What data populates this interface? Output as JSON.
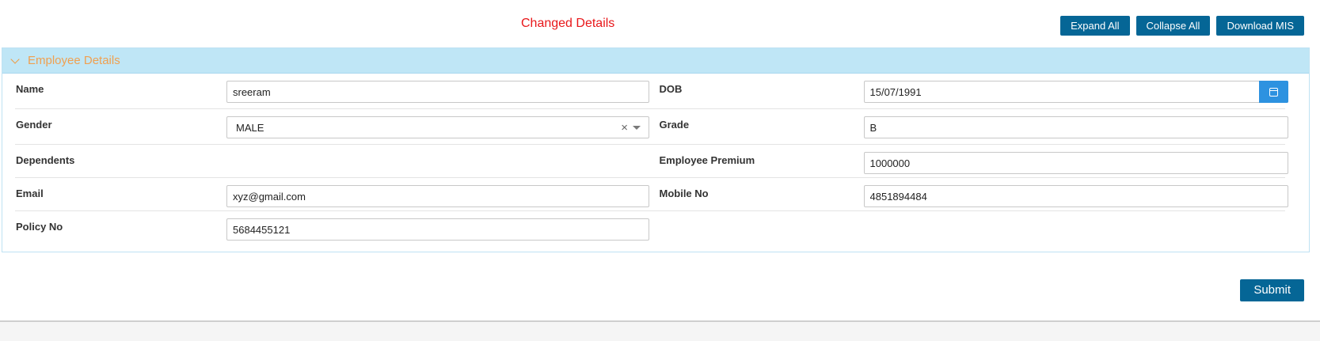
{
  "page": {
    "title": "Changed Details"
  },
  "toolbar": {
    "expand_all": "Expand All",
    "collapse_all": "Collapse All",
    "download_mis": "Download MIS"
  },
  "panel": {
    "title": "Employee Details",
    "fields": {
      "name": {
        "label": "Name",
        "value": "sreeram"
      },
      "dob": {
        "label": "DOB",
        "value": "15/07/1991"
      },
      "gender": {
        "label": "Gender",
        "value": "MALE",
        "clear": "×"
      },
      "grade": {
        "label": "Grade",
        "value": "B"
      },
      "dependents": {
        "label": "Dependents"
      },
      "employee_premium": {
        "label": "Employee Premium",
        "value": "1000000"
      },
      "email": {
        "label": "Email",
        "value": "xyz@gmail.com"
      },
      "mobile_no": {
        "label": "Mobile No",
        "value": "4851894484"
      },
      "policy_no": {
        "label": "Policy No",
        "value": "5684455121"
      }
    }
  },
  "actions": {
    "submit": "Submit"
  },
  "icons": {
    "header": "chevron-down-icon",
    "date": "calendar-icon",
    "select_clear": "clear-icon",
    "select_caret": "caret-down-icon"
  },
  "colors": {
    "primary_button": "#056696",
    "title_red": "#e8171a",
    "panel_header_bg": "#bfe6f6",
    "panel_title": "#f0a050",
    "calendar_button": "#2d92e0"
  }
}
